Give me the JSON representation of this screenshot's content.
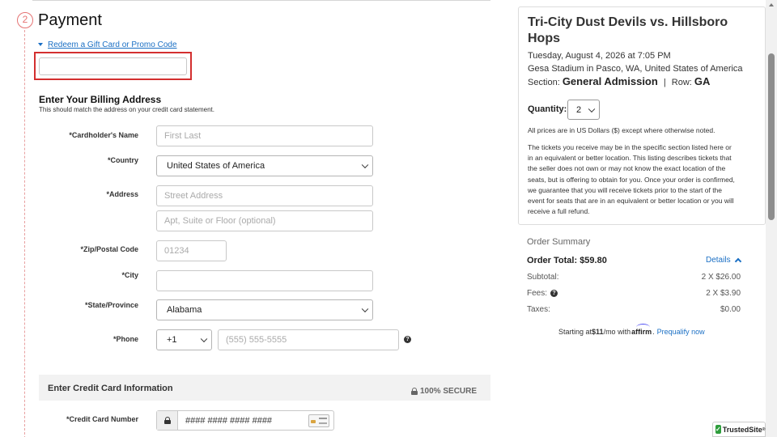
{
  "payment": {
    "step_number": "2",
    "title": "Payment",
    "promo_link": "Redeem a Gift Card or Promo Code",
    "promo_value": ""
  },
  "billing": {
    "title": "Enter Your Billing Address",
    "subtitle": "This should match the address on your credit card statement.",
    "cardholder_label": "*Cardholder's Name",
    "cardholder_placeholder": "First Last",
    "country_label": "*Country",
    "country_value": "United States of America",
    "address_label": "*Address",
    "address_placeholder": "Street Address",
    "address2_placeholder": "Apt, Suite or Floor (optional)",
    "zip_label": "*Zip/Postal Code",
    "zip_placeholder": "01234",
    "city_label": "*City",
    "state_label": "*State/Province",
    "state_value": "Alabama",
    "phone_label": "*Phone",
    "phone_code": "+1",
    "phone_placeholder": "(555) 555-5555"
  },
  "credit_card": {
    "title": "Enter Credit Card Information",
    "secure_label": "100% SECURE",
    "number_label": "*Credit Card Number",
    "number_placeholder": "#### #### #### ####"
  },
  "event": {
    "title": "Tri-City Dust Devils vs. Hillsboro Hops",
    "datetime": "Tuesday, August 4, 2026 at 7:05 PM",
    "venue": "Gesa Stadium in Pasco, WA, United States of America",
    "section_label": "Section:",
    "section_value": "General Admission",
    "separator": "|",
    "row_label": "Row:",
    "row_value": "GA",
    "quantity_label": "Quantity:",
    "quantity_value": "2",
    "currency_note": "All prices are in US Dollars ($) except where otherwise noted.",
    "guarantee_note": "The tickets you receive may be in the specific section listed here or in an equivalent or better location. This listing describes tickets that the seller does not own or may not know the exact location of the seats, but is offering to obtain for you. Once your order is confirmed, we guarantee that you will receive tickets prior to the start of the event for seats that are in an equivalent or better location or you will receive a full refund."
  },
  "summary": {
    "heading": "Order Summary",
    "total_label": "Order Total: $59.80",
    "details_link": "Details",
    "subtotal_label": "Subtotal:",
    "subtotal_value": "2 X $26.00",
    "fees_label": "Fees:",
    "fees_value": "2 X $3.90",
    "taxes_label": "Taxes:",
    "taxes_value": "$0.00"
  },
  "affirm": {
    "prefix": "Starting at ",
    "amount": "$11",
    "suffix": "/mo with",
    "logo": "affirm",
    "link": "Prequalify now"
  },
  "trust_badge": {
    "name": "TrustedSite",
    "mark": "®"
  },
  "colors": {
    "accent_link": "#1a6fc4",
    "highlight_red": "#d32f2f",
    "step_red": "#e57373"
  }
}
